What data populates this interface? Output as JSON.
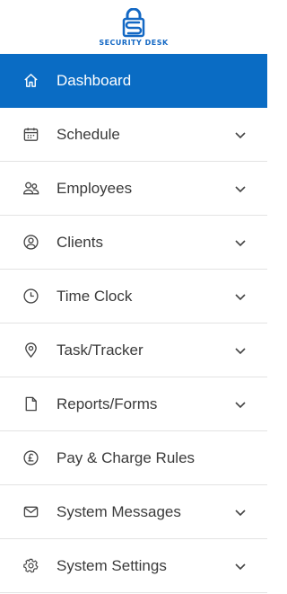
{
  "brand": {
    "name": "Security Desk",
    "accent": "#1368c4"
  },
  "colors": {
    "active_bg": "#0a6cc4",
    "text": "#3a3a3a",
    "icon": "#444444"
  },
  "nav": [
    {
      "label": "Dashboard",
      "icon": "home-icon",
      "active": true,
      "has_submenu": false
    },
    {
      "label": "Schedule",
      "icon": "calendar-icon",
      "active": false,
      "has_submenu": true
    },
    {
      "label": "Employees",
      "icon": "users-icon",
      "active": false,
      "has_submenu": true
    },
    {
      "label": "Clients",
      "icon": "user-circle-icon",
      "active": false,
      "has_submenu": true
    },
    {
      "label": "Time Clock",
      "icon": "clock-icon",
      "active": false,
      "has_submenu": true
    },
    {
      "label": "Task/Tracker",
      "icon": "map-pin-icon",
      "active": false,
      "has_submenu": true
    },
    {
      "label": "Reports/Forms",
      "icon": "file-icon",
      "active": false,
      "has_submenu": true
    },
    {
      "label": "Pay & Charge Rules",
      "icon": "pound-coin-icon",
      "active": false,
      "has_submenu": false
    },
    {
      "label": "System Messages",
      "icon": "envelope-icon",
      "active": false,
      "has_submenu": true
    },
    {
      "label": "System Settings",
      "icon": "gear-icon",
      "active": false,
      "has_submenu": true
    }
  ]
}
